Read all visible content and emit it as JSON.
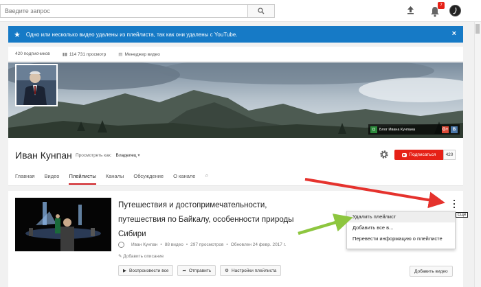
{
  "topbar": {
    "search_placeholder": "Введите запрос",
    "notification_count": "7"
  },
  "notification": {
    "text": "Одно или несколько видео удалены из плейлиста, так как они удалены с YouTube.",
    "close_label": "×"
  },
  "stats": {
    "subscribers": "420 подписчиков",
    "views": "114 731 просмотр",
    "video_manager": "Менеджер видео"
  },
  "banner": {
    "blog_link": "Блог Ивана Кунпана"
  },
  "channel": {
    "name": "Иван Кунпан",
    "view_as_label": "Просмотреть как:",
    "view_as_value": "Владелец",
    "subscribe_label": "Подписаться",
    "subscriber_count": "420"
  },
  "tabs": [
    {
      "label": "Главная"
    },
    {
      "label": "Видео"
    },
    {
      "label": "Плейлисты"
    },
    {
      "label": "Каналы"
    },
    {
      "label": "Обсуждение"
    },
    {
      "label": "О канале"
    }
  ],
  "playlist": {
    "title": "Путешествия и достопримечательности, путешествия по Байкалу, особенности природы Сибири",
    "author": "Иван Кунпан",
    "video_count": "88 видео",
    "views": "297 просмотров",
    "updated": "Обновлен 24 февр. 2017 г.",
    "add_description": "Добавить описание",
    "play_all": "Воспроизвести все",
    "share": "Отправить",
    "settings": "Настройки плейлиста",
    "add_video": "Добавить видео",
    "more_tooltip": "Ещё",
    "meta_sep": "•"
  },
  "menu": {
    "items": [
      {
        "label": "Удалить плейлист"
      },
      {
        "label": "Добавить все в..."
      },
      {
        "label": "Перевести информацию о плейлисте"
      }
    ]
  },
  "colors": {
    "accent_blue": "#167ac6",
    "subscribe_red": "#e62117",
    "arrow_red": "#e5322d",
    "arrow_green": "#8dc63f"
  }
}
